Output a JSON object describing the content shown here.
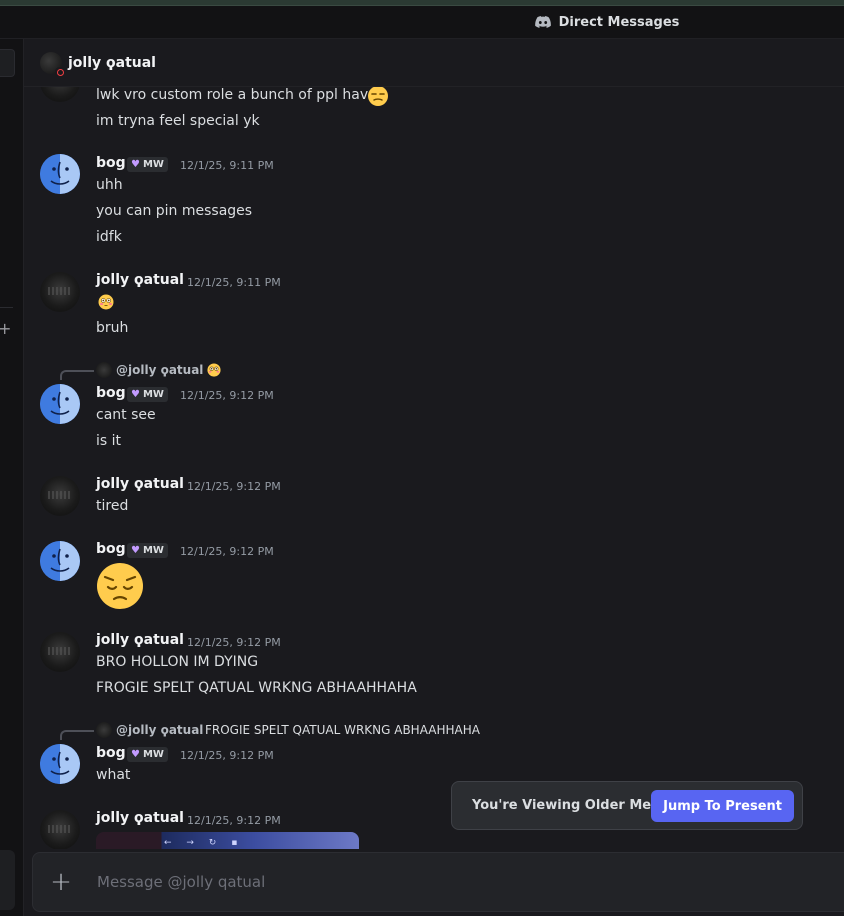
{
  "window": {
    "title": "Direct Messages",
    "title_icon": "discord-icon"
  },
  "header": {
    "name": "jolly ϙatual",
    "status_color": "#f23f43"
  },
  "messages": {
    "m0": {
      "lines": [
        "lwk vro custom role a bunch of ppl have",
        "im tryna feel special yk"
      ],
      "emoji": "unamused-face"
    },
    "m1": {
      "author": "bog",
      "tag": "MW",
      "time": "12/1/25, 9:11 PM",
      "lines": [
        "uhh",
        "you can pin messages",
        "idfk"
      ]
    },
    "m2": {
      "author": "jolly ϙatual",
      "time": "12/1/25, 9:11 PM",
      "emoji": "flushed-face",
      "lines": [
        "bruh"
      ]
    },
    "m3": {
      "reply_author": "@jolly ϙatual",
      "reply_emoji": "flushed-face",
      "author": "bog",
      "tag": "MW",
      "time": "12/1/25, 9:12 PM",
      "lines": [
        "cant see",
        "is it"
      ]
    },
    "m4": {
      "author": "jolly ϙatual",
      "time": "12/1/25, 9:12 PM",
      "lines": [
        "tired"
      ]
    },
    "m5": {
      "author": "bog",
      "tag": "MW",
      "time": "12/1/25, 9:12 PM",
      "emoji": "pensive-face"
    },
    "m6": {
      "author": "jolly ϙatual",
      "time": "12/1/25, 9:12 PM",
      "lines": [
        "BRO HOLLON IM DYING",
        "FROGIE SPELT QATUAL WRKNG ABHAAHHAHA"
      ]
    },
    "m7": {
      "reply_author": "@jolly ϙatual",
      "reply_text": "FROGIE SPELT QATUAL WRKNG ABHAAHHAHA",
      "author": "bog",
      "tag": "MW",
      "time": "12/1/25, 9:12 PM",
      "lines": [
        "what"
      ]
    },
    "m8": {
      "author": "jolly ϙatual",
      "time": "12/1/25, 9:12 PM",
      "attachment": "screenshot-image"
    }
  },
  "older_toast": {
    "text": "You're Viewing Older Messages",
    "button": "Jump To Present"
  },
  "composer": {
    "placeholder": "Message @jolly qatual"
  },
  "colors": {
    "accent": "#5865f2",
    "background": "#1a1a1e",
    "role_heart": "#c39bff"
  }
}
